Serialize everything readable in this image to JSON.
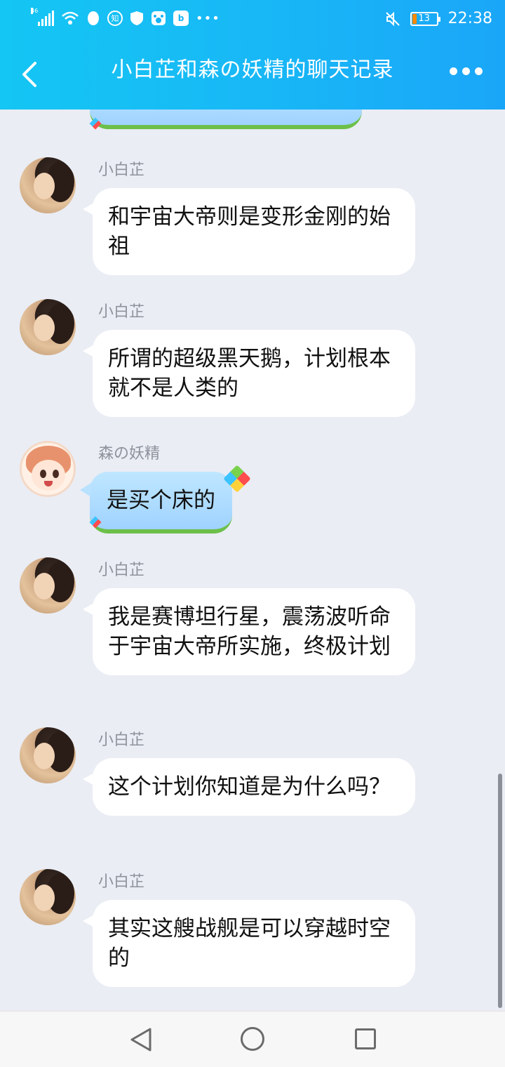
{
  "status_bar": {
    "network_label": "46",
    "zhi_badge": "知",
    "battery_level": "13",
    "time": "22:38"
  },
  "header": {
    "title": "小白芷和森の妖精的聊天记录"
  },
  "messages": [
    {
      "sender": "小白芷",
      "text": "和宇宙大帝则是变形金刚的始祖"
    },
    {
      "sender": "小白芷",
      "text": "所谓的超级黑天鹅，计划根本就不是人类的"
    },
    {
      "sender": "森の妖精",
      "text": "是买个床的"
    },
    {
      "sender": "小白芷",
      "text": "我是赛博坦行星，震荡波听命于宇宙大帝所实施，终极计划"
    },
    {
      "sender": "小白芷",
      "text": "这个计划你知道是为什么吗？"
    },
    {
      "sender": "小白芷",
      "text": "其实这艘战舰是可以穿越时空的"
    }
  ],
  "colors": {
    "header_start": "#14c6f3",
    "header_end": "#1aa6f8",
    "chat_bg": "#eaedf4",
    "bubble_blue": "#a9d9ff",
    "bubble_grass": "#6cc04a"
  }
}
